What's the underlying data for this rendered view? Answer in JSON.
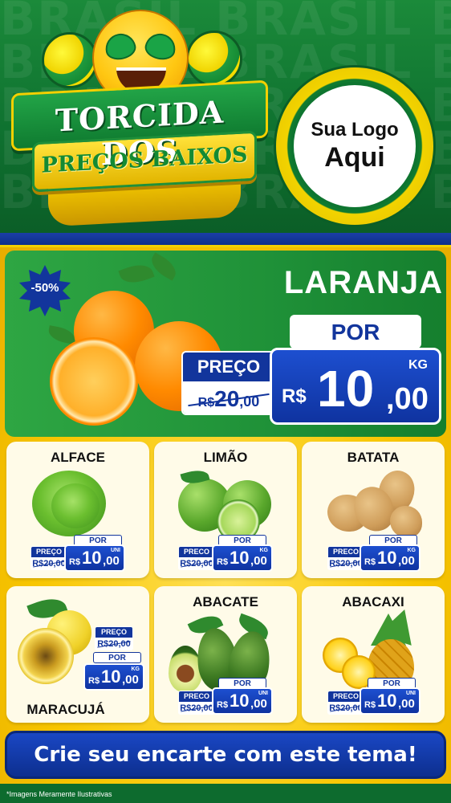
{
  "header": {
    "bg_word": "BRASIL",
    "title_line1": "TORCIDA DOS",
    "title_line2": "PREÇOS BAIXOS",
    "logo_line1": "Sua Logo",
    "logo_line2": "Aqui"
  },
  "featured": {
    "discount_badge": "-50%",
    "name": "LARANJA",
    "por_label": "POR",
    "preco_label": "PREÇO",
    "old_price": {
      "currency": "R$",
      "integer": "20",
      "cents": ",00"
    },
    "new_price": {
      "currency": "R$",
      "integer": "10",
      "cents": ",00",
      "unit": "KG"
    }
  },
  "products": [
    {
      "name": "ALFACE",
      "preco_label": "PREÇO",
      "old_price": "R$20,00",
      "por_label": "POR",
      "currency": "R$",
      "integer": "10",
      "cents": ",00",
      "unit": "UNI"
    },
    {
      "name": "LIMÃO",
      "preco_label": "PRECO",
      "old_price": "R$20,00",
      "por_label": "POR",
      "currency": "R$",
      "integer": "10",
      "cents": ",00",
      "unit": "KG"
    },
    {
      "name": "BATATA",
      "preco_label": "PRECO",
      "old_price": "R$20,00",
      "por_label": "POR",
      "currency": "R$",
      "integer": "10",
      "cents": ",00",
      "unit": "KG"
    },
    {
      "name": "MARACUJÁ",
      "preco_label": "PREÇO",
      "old_price": "R$20,00",
      "por_label": "POR",
      "currency": "R$",
      "integer": "10",
      "cents": ",00",
      "unit": "KG"
    },
    {
      "name": "ABACATE",
      "preco_label": "PRECO",
      "old_price": "R$20,00",
      "por_label": "POR",
      "currency": "R$",
      "integer": "10",
      "cents": ",00",
      "unit": "UNI"
    },
    {
      "name": "ABACAXI",
      "preco_label": "PRECO",
      "old_price": "R$20,00",
      "por_label": "POR",
      "currency": "R$",
      "integer": "10",
      "cents": ",00",
      "unit": "UNI"
    }
  ],
  "cta": {
    "text": "Crie seu encarte com este tema!"
  },
  "footer": {
    "note": "*Imagens Meramente Ilustrativas"
  },
  "colors": {
    "green": "#1f9138",
    "yellow": "#f8c600",
    "blue": "#12359c",
    "white": "#ffffff"
  }
}
